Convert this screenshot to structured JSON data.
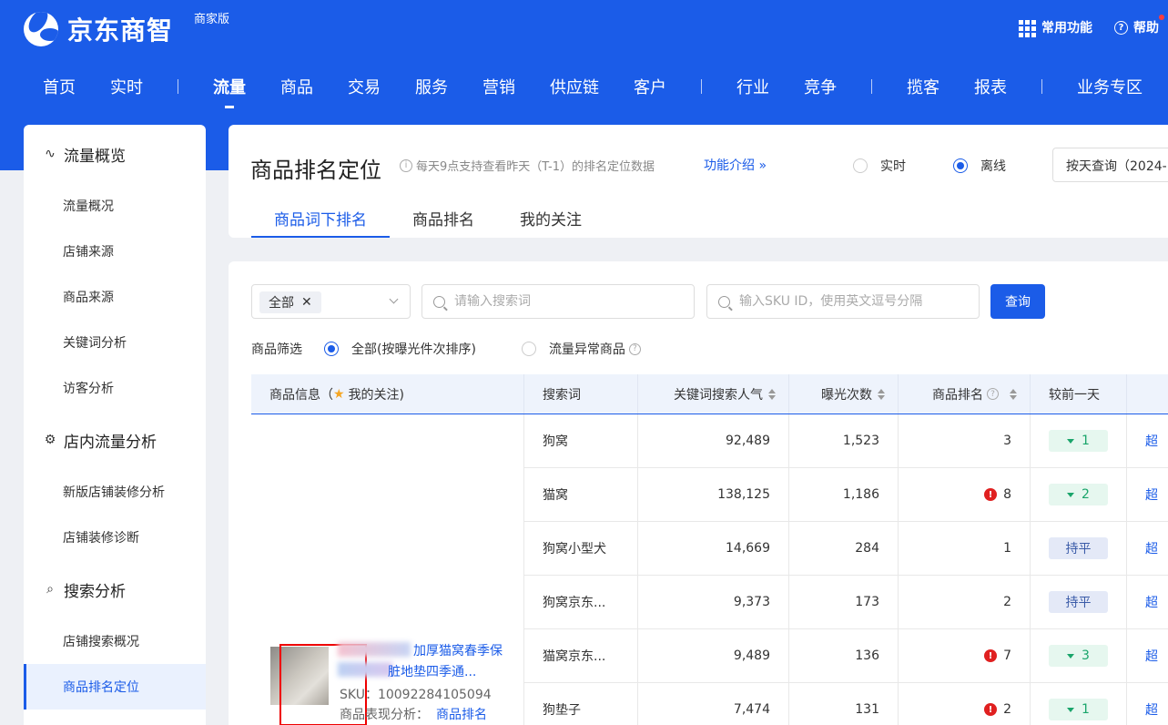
{
  "header": {
    "logo_text": "京东商智",
    "edition": "商家版",
    "common_functions": "常用功能",
    "help": "帮助"
  },
  "nav": [
    {
      "label": "首页",
      "active": false
    },
    {
      "label": "实时",
      "active": false
    },
    {
      "sep": true
    },
    {
      "label": "流量",
      "active": true
    },
    {
      "label": "商品",
      "active": false
    },
    {
      "label": "交易",
      "active": false
    },
    {
      "label": "服务",
      "active": false
    },
    {
      "label": "营销",
      "active": false
    },
    {
      "label": "供应链",
      "active": false
    },
    {
      "label": "客户",
      "active": false
    },
    {
      "sep": true
    },
    {
      "label": "行业",
      "active": false
    },
    {
      "label": "竞争",
      "active": false
    },
    {
      "sep": true
    },
    {
      "label": "揽客",
      "active": false
    },
    {
      "label": "报表",
      "active": false
    },
    {
      "sep": true
    },
    {
      "label": "业务专区",
      "active": false
    }
  ],
  "sidebar": [
    {
      "type": "group",
      "label": "流量概览",
      "icon": "pulse-icon"
    },
    {
      "type": "item",
      "label": "流量概况"
    },
    {
      "type": "item",
      "label": "店铺来源"
    },
    {
      "type": "item",
      "label": "商品来源"
    },
    {
      "type": "item",
      "label": "关键词分析"
    },
    {
      "type": "item",
      "label": "访客分析"
    },
    {
      "type": "group",
      "label": "店内流量分析",
      "icon": "flow-icon"
    },
    {
      "type": "item",
      "label": "新版店铺装修分析"
    },
    {
      "type": "item",
      "label": "店铺装修诊断"
    },
    {
      "type": "group",
      "label": "搜索分析",
      "icon": "search-analysis-icon"
    },
    {
      "type": "item",
      "label": "店铺搜索概况"
    },
    {
      "type": "item",
      "label": "商品排名定位",
      "active": true
    }
  ],
  "page": {
    "title": "商品排名定位",
    "tip": "每天9点支持查看昨天（T-1）的排名定位数据",
    "intro_link": "功能介绍 »",
    "radio_realtime": "实时",
    "radio_offline": "离线",
    "date_query": "按天查询（2024-"
  },
  "tabs": [
    {
      "label": "商品词下排名",
      "active": true
    },
    {
      "label": "商品排名",
      "active": false
    },
    {
      "label": "我的关注",
      "active": false
    }
  ],
  "filters": {
    "select_tag": "全部",
    "keyword_placeholder": "请输入搜索词",
    "sku_placeholder": "输入SKU ID，使用英文逗号分隔",
    "query_button": "查询",
    "filter_label": "商品筛选",
    "option_all": "全部(按曝光件次排序)",
    "option_abnormal": "流量异常商品"
  },
  "table": {
    "headers": {
      "product_prefix": "商品信息（",
      "product_follow": "我的关注)",
      "keyword": "搜索词",
      "popularity": "关键词搜索人气",
      "exposure": "曝光次数",
      "rank": "商品排名",
      "change": "较前一天"
    },
    "product": {
      "name_line1": "加厚猫窝春季保",
      "name_line2": "脏地垫四季通...",
      "sku": "SKU：10092284105094",
      "analysis_label": "商品表现分析：",
      "analysis_link": "商品排名"
    },
    "rows": [
      {
        "keyword": "狗窝",
        "popularity": "92,489",
        "exposure": "1,523",
        "rank": "3",
        "warn": false,
        "change": "1",
        "dir": "down",
        "more": "超"
      },
      {
        "keyword": "猫窝",
        "popularity": "138,125",
        "exposure": "1,186",
        "rank": "8",
        "warn": true,
        "change": "2",
        "dir": "down",
        "more": "超"
      },
      {
        "keyword": "狗窝小型犬",
        "popularity": "14,669",
        "exposure": "284",
        "rank": "1",
        "warn": false,
        "change": "持平",
        "dir": "flat",
        "more": "超"
      },
      {
        "keyword": "狗窝京东...",
        "popularity": "9,373",
        "exposure": "173",
        "rank": "2",
        "warn": false,
        "change": "持平",
        "dir": "flat",
        "more": "超"
      },
      {
        "keyword": "猫窝京东...",
        "popularity": "9,489",
        "exposure": "136",
        "rank": "7",
        "warn": true,
        "change": "3",
        "dir": "down",
        "more": "超"
      },
      {
        "keyword": "狗垫子",
        "popularity": "7,474",
        "exposure": "131",
        "rank": "2",
        "warn": true,
        "change": "1",
        "dir": "down",
        "more": "超"
      }
    ]
  }
}
